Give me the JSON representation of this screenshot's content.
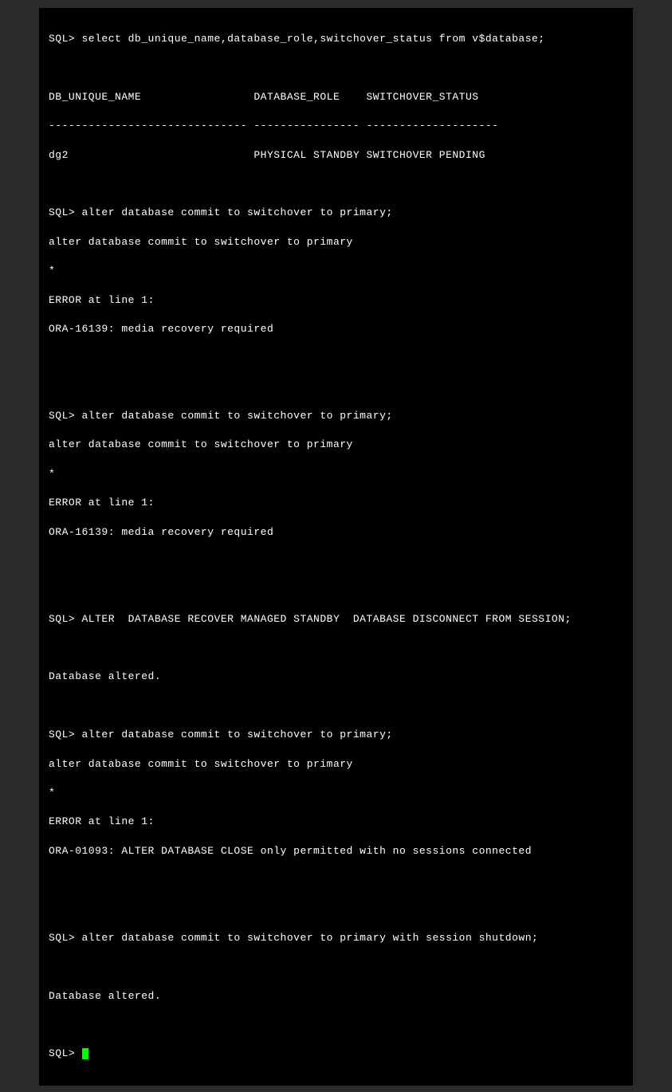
{
  "terminal": {
    "lines": [
      "SQL> select db_unique_name,database_role,switchover_status from v$database;",
      "",
      "DB_UNIQUE_NAME                 DATABASE_ROLE    SWITCHOVER_STATUS",
      "------------------------------ ---------------- --------------------",
      "dg2                            PHYSICAL STANDBY SWITCHOVER PENDING",
      "",
      "SQL> alter database commit to switchover to primary;",
      "alter database commit to switchover to primary",
      "*",
      "ERROR at line 1:",
      "ORA-16139: media recovery required",
      "",
      "",
      "SQL> alter database commit to switchover to primary;",
      "alter database commit to switchover to primary",
      "*",
      "ERROR at line 1:",
      "ORA-16139: media recovery required",
      "",
      "",
      "SQL> ALTER  DATABASE RECOVER MANAGED STANDBY  DATABASE DISCONNECT FROM SESSION;",
      "",
      "Database altered.",
      "",
      "SQL> alter database commit to switchover to primary;",
      "alter database commit to switchover to primary",
      "*",
      "ERROR at line 1:",
      "ORA-01093: ALTER DATABASE CLOSE only permitted with no sessions connected",
      "",
      "",
      "SQL> alter database commit to switchover to primary with session shutdown;",
      "",
      "Database altered.",
      "",
      "SQL> "
    ]
  }
}
